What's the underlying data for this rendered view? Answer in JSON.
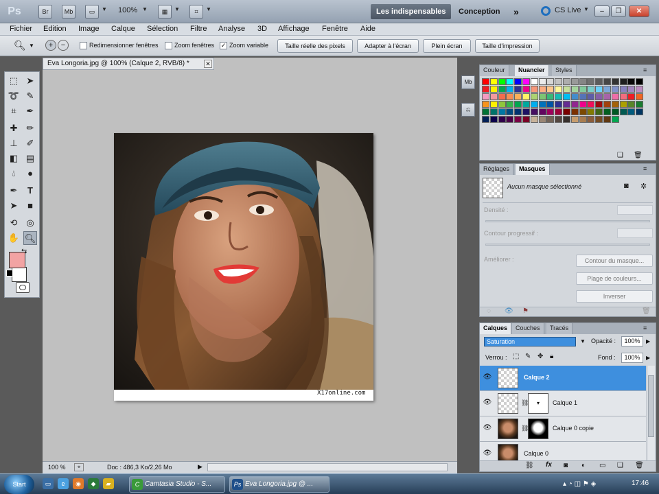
{
  "appbar": {
    "logo": "Ps",
    "br_label": "Br",
    "mb_label": "Mb",
    "zoom": "100%",
    "workspaces": [
      "Les indispensables",
      "Conception"
    ],
    "more": "»",
    "cslive": "CS Live"
  },
  "menu": [
    "Fichier",
    "Edition",
    "Image",
    "Calque",
    "Sélection",
    "Filtre",
    "Analyse",
    "3D",
    "Affichage",
    "Fenêtre",
    "Aide"
  ],
  "options": {
    "check1": "Redimensionner fenêtres",
    "check2": "Zoom fenêtres",
    "check3": "Zoom variable",
    "btn1": "Taille réelle des pixels",
    "btn2": "Adapter à l'écran",
    "btn3": "Plein écran",
    "btn4": "Taille d'impression"
  },
  "document": {
    "tab_title": "Eva Longoria.jpg @ 100% (Calque 2, RVB/8) *",
    "watermark": "X17online.com",
    "status_zoom": "100 %",
    "status_doc": "Doc : 486,3 Ko/2,26 Mo"
  },
  "swatch_panel": {
    "tabs": [
      "Couleur",
      "Nuancier",
      "Styles"
    ]
  },
  "mask_panel": {
    "tabs": [
      "Réglages",
      "Masques"
    ],
    "none_selected": "Aucun masque sélectionné",
    "density": "Densité :",
    "feather": "Contour progressif :",
    "refine": "Améliorer :",
    "btn_mask_edge": "Contour du masque...",
    "btn_color_range": "Plage de couleurs...",
    "btn_invert": "Inverser"
  },
  "layers_panel": {
    "tabs": [
      "Calques",
      "Couches",
      "Tracés"
    ],
    "blend_mode": "Saturation",
    "opacity_label": "Opacité :",
    "opacity_value": "100%",
    "lock_label": "Verrou :",
    "fill_label": "Fond :",
    "fill_value": "100%",
    "layers": [
      "Calque 2",
      "Calque 1",
      "Calque 0 copie",
      "Calque 0"
    ]
  },
  "taskbar": {
    "start": "Start",
    "app1": "Camtasia Studio - S...",
    "app2": "Eva Longoria.jpg @ ...",
    "clock": "17:46"
  },
  "colors": {
    "foreground": "#f2a3a3",
    "background": "#ffffff",
    "selection_blue": "#3e8fde"
  }
}
